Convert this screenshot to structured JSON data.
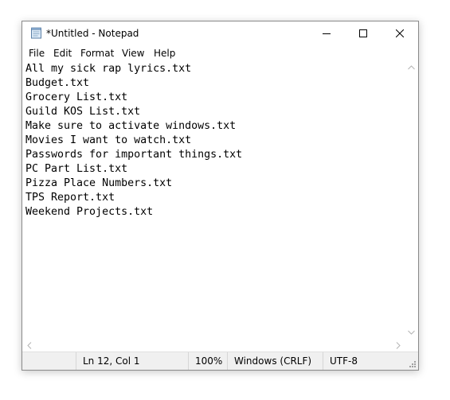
{
  "window": {
    "title": "*Untitled - Notepad",
    "app_icon": "notepad-icon",
    "controls": [
      "minimize-icon",
      "maximize-icon",
      "close-icon"
    ]
  },
  "menu": {
    "items": [
      "File",
      "Edit",
      "Format",
      "View",
      "Help"
    ]
  },
  "editor": {
    "lines": [
      "All my sick rap lyrics.txt",
      "Budget.txt",
      "Grocery List.txt",
      "Guild KOS List.txt",
      "Make sure to activate windows.txt",
      "Movies I want to watch.txt",
      "Passwords for important things.txt",
      "PC Part List.txt",
      "Pizza Place Numbers.txt",
      "TPS Report.txt",
      "Weekend Projects.txt"
    ]
  },
  "status": {
    "position": "Ln 12, Col 1",
    "zoom": "100%",
    "line_endings": "Windows (CRLF)",
    "encoding": "UTF-8"
  },
  "colors": {
    "text": "#000000",
    "statusbar_bg": "#f0f0f0",
    "window_border": "#8a8a8a",
    "scroll_arrow": "#b4b4b4"
  }
}
